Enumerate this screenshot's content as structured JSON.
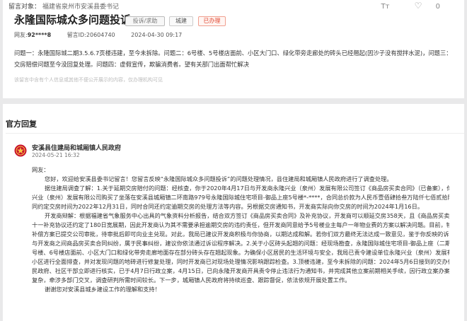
{
  "header": {
    "target_label": "留言对象：",
    "target_value": "福建省泉州市安溪县委书记",
    "font_icon_label": "Tт",
    "like_count": "0"
  },
  "message": {
    "title": "永隆国际城众多问题投诉",
    "tags": {
      "type": "投诉/求助",
      "category": "城建",
      "status": "已办理"
    },
    "user_label": "网友:",
    "user_name": "92****8",
    "id_text": "留言ID:20604740",
    "datetime": "2024-04-30 09:17",
    "content_lines": [
      "问题一：永隆国际城二期3.5.6.7页楼违建，至今未拆除。问题二：6号楼、5号楼店面前、小区大门口、绿化带旁走廊处的砖头已经翘起(因沙子没有搅拌水泥)，问题三：5号楼延期",
      "交房赔偿问题至今没回复处理。问题四：虚假宣传，欺骗消费者。望有关部门出面帮忙解决"
    ],
    "privacy_note": "该留言中含有个人信息或其他不便公开展示的内容，仅办理机构可见"
  },
  "reply": {
    "section_title": "官方回复",
    "gov_name": "安溪县住建局和城厢镇人民政府",
    "date": "2024-05-21 16:32",
    "lines": [
      "网友：",
      "您好，欢迎给安溪县委书记留言！您留言反映“永隆国际城众多问题投诉”的问题处理情况，县住建局和城厢镇人民政府进行了调查处理。",
      "据住建局调查了解：1.关于延期交房赔付的问题：经核查，你于2020年4月17日与开发商永隆兴业（泉州）发展有限公司签订《商品房买卖合同》（已备案），你向永隆",
      "兴业（泉州）发展有限公司购买了坐落在安溪县城厢镇二环南路979号永隆国际城住宅项目-御品上座5号楼*-****，合同总价款为人民币壹佰肆拾叁万陆仟七佰贰拾陆元整，合",
      "同约定交房时间为2022年12月31日，同时合同还约定逾期交房的处理方法等内容。另根据交房通知书，开发商实际向你交房的时间为2024年1月16日。",
      "开发商辩解：根据福建省气象服务中心出具的气象资料分析报告，结合双方签订《商品房买卖合同》及补充协议，开发商可以顺延交房358天，且《商品房买卖合同》附件",
      "十一补充协议还约定了180日宽展期，因此开发商认为其不需要承担逾期交房的违约责任，但开发商同意给予5号楼业主每户一年物业费的方案以解决问题。目前，物业费",
      "补偿方案已提交公司审批，待审批后即可向业主兑现。对此，我局已建议开发商积极与你协商，以期达成和解。若你们双方最终无法达成一致意见，鉴于你反映的诉求属于你",
      "与开发商之间商品房买卖合同纠纷，属于民事纠纷，建议你依法通过诉讼程序解决。2.关于小区砖头起翘的问题：经现场勘查，永隆国际城住宅项目-御品上座（二期二组团）项目5",
      "号楼、6号楼店面前、小区大门口和绿化带旁走廊地面存在部分砖头存在翘起现象。为确保小区居民的生活环境与安全，我局已责令建设单位永隆兴业（泉州）发展有限公司对",
      "小区进行全面排查，并对发现问题的地砖进行修复处理，同时开发商已对现场处理情况影响跟踪检查。3.顶楼违建，至今未拆除的问题：2024年5月6日接到的交办件，城厢镇人",
      "民政府、社区干部立即进行核实，已于4月7日行政立案，4月15日，已向永隆开发商开具责令停止违法行为通知书，并完成其他立案前期相关手续，因行政立案办案法定程序",
      "复杂，牵涉多部门交叉，调查研判所需时间较长。下一步，城厢镇人民政府将持续巡查、跟踪督促，依法依规开展处置工作。",
      "谢谢您对安溪县城乡建设工作的理解和支持！"
    ]
  },
  "colors": {
    "status_red": "#e0452f",
    "background": "#e9e9ea"
  }
}
